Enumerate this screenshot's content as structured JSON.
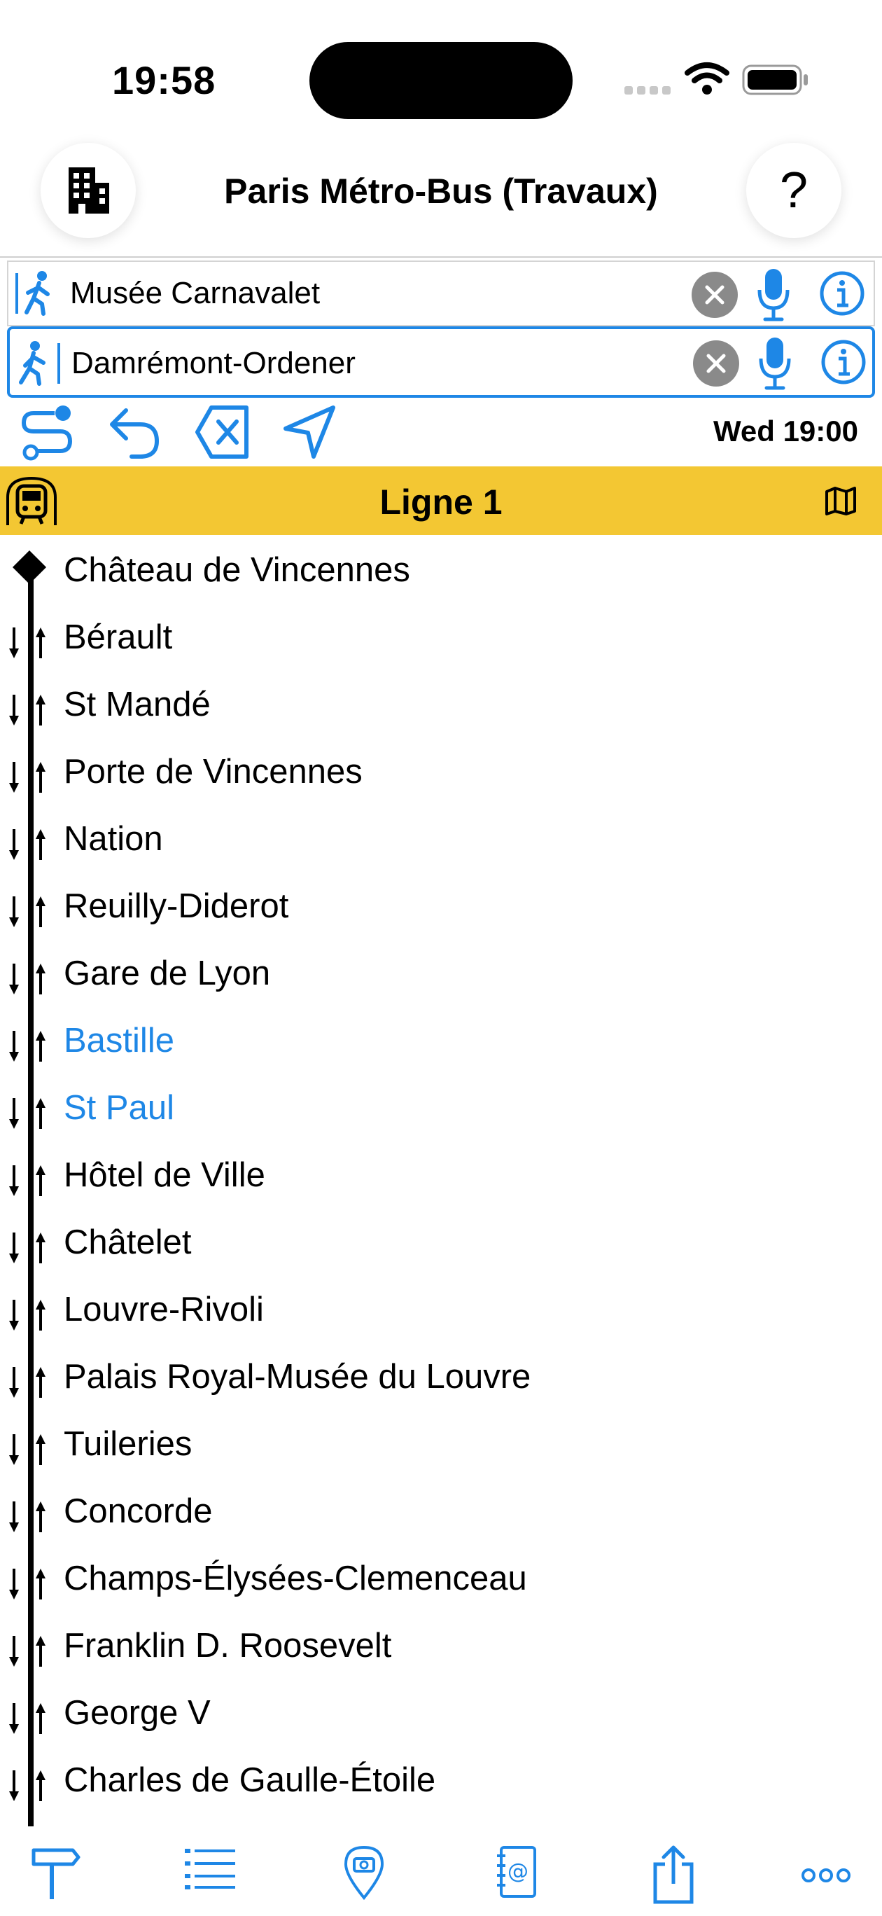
{
  "status_bar": {
    "time": "19:58"
  },
  "nav": {
    "title": "Paris Métro-Bus (Travaux)",
    "help_label": "?"
  },
  "from": {
    "value": "Musée Carnavalet"
  },
  "to": {
    "value": "Damrémont-Ordener"
  },
  "toolbar": {
    "time_label": "Wed 19:00"
  },
  "line": {
    "title": "Ligne 1",
    "color": "#f3c733"
  },
  "accent_color": "#1e87e6",
  "stops": [
    {
      "name": "Château de Vincennes",
      "highlighted": false,
      "terminus": true
    },
    {
      "name": "Bérault",
      "highlighted": false
    },
    {
      "name": "St Mandé",
      "highlighted": false
    },
    {
      "name": "Porte de Vincennes",
      "highlighted": false
    },
    {
      "name": "Nation",
      "highlighted": false
    },
    {
      "name": "Reuilly-Diderot",
      "highlighted": false
    },
    {
      "name": "Gare de Lyon",
      "highlighted": false
    },
    {
      "name": "Bastille",
      "highlighted": true
    },
    {
      "name": "St Paul",
      "highlighted": true
    },
    {
      "name": "Hôtel de Ville",
      "highlighted": false
    },
    {
      "name": "Châtelet",
      "highlighted": false
    },
    {
      "name": "Louvre-Rivoli",
      "highlighted": false
    },
    {
      "name": "Palais Royal-Musée du Louvre",
      "highlighted": false
    },
    {
      "name": "Tuileries",
      "highlighted": false
    },
    {
      "name": "Concorde",
      "highlighted": false
    },
    {
      "name": "Champs-Élysées-Clemenceau",
      "highlighted": false
    },
    {
      "name": "Franklin D. Roosevelt",
      "highlighted": false
    },
    {
      "name": "George V",
      "highlighted": false
    },
    {
      "name": "Charles de Gaulle-Étoile",
      "highlighted": false
    }
  ],
  "tabs": [
    "signpost-icon",
    "list-icon",
    "location-camera-icon",
    "address-book-icon",
    "share-icon",
    "more-icon"
  ]
}
